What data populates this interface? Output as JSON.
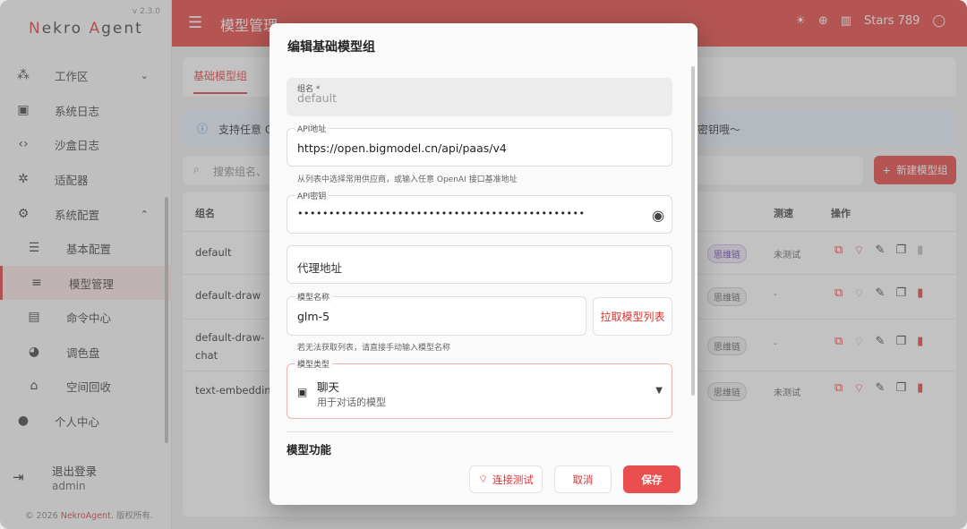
{
  "sidebar": {
    "brand_prefix": "N",
    "brand_main": "ekro ",
    "brand_a": "A",
    "brand_rest": "gent",
    "version": "v 2.3.0",
    "items": [
      {
        "label": "工作区",
        "icon": "workspace-icon",
        "glyph": "⁂"
      },
      {
        "label": "系统日志",
        "icon": "terminal-icon",
        "glyph": "▣"
      },
      {
        "label": "沙盒日志",
        "icon": "code-icon",
        "glyph": "‹›"
      },
      {
        "label": "适配器",
        "icon": "hub-icon",
        "glyph": "✲"
      },
      {
        "label": "系统配置",
        "icon": "gear-icon",
        "glyph": "⚙"
      },
      {
        "label": "基本配置",
        "icon": "tune-icon",
        "glyph": "☰"
      },
      {
        "label": "模型管理",
        "icon": "storage-icon",
        "glyph": "≡"
      },
      {
        "label": "命令中心",
        "icon": "list-icon",
        "glyph": "▤"
      },
      {
        "label": "调色盘",
        "icon": "palette-icon",
        "glyph": "◕"
      },
      {
        "label": "空间回收",
        "icon": "broom-icon",
        "glyph": "⌂"
      },
      {
        "label": "个人中心",
        "icon": "account-icon",
        "glyph": "●"
      }
    ],
    "logout_label": "退出登录",
    "user": "admin",
    "copyright_prefix": "© 2026 ",
    "copyright_brand": "NekroAgent",
    "copyright_suffix": ". 版权所有."
  },
  "topbar": {
    "title": "模型管理",
    "stars": "Stars 789"
  },
  "page": {
    "tab": "基础模型组",
    "info_start": "支持任意 C",
    "info_end": "密钥哦～",
    "search_placeholder": "搜索组名、",
    "new_button": "新建模型组",
    "columns": {
      "name": "组名",
      "speed": "测速",
      "ops": "操作"
    },
    "rows": [
      {
        "name": "default",
        "chip": "思维链",
        "test": "未测试"
      },
      {
        "name": "default-draw",
        "chip": "思维链",
        "test": "-"
      },
      {
        "name": "default-draw-\nchat",
        "chip": "思维链",
        "test": "-"
      },
      {
        "name": "text-embedding",
        "chip": "思维链",
        "test": "未测试"
      }
    ]
  },
  "dialog": {
    "title": "编辑基础模型组",
    "group_name_label": "组名 *",
    "group_name_value": "default",
    "api_url_label": "API地址",
    "api_url_value": "https://open.bigmodel.cn/api/paas/v4",
    "api_url_helper": "从列表中选择常用供应商，或输入任意 OpenAI 接口基准地址",
    "api_key_label": "API密钥",
    "api_key_value": "••••••••••••••••••••••••••••••••••••••••••••••",
    "proxy_placeholder": "代理地址",
    "model_name_label": "模型名称",
    "model_name_value": "glm-5",
    "pull_models_button": "拉取模型列表",
    "model_name_helper": "若无法获取列表，请直接手动输入模型名称",
    "model_type_label": "模型类型",
    "model_type_value": "聊天",
    "model_type_desc": "用于对话的模型",
    "section_title": "模型功能",
    "test_button": "连接测试",
    "cancel_button": "取消",
    "save_button": "保存"
  },
  "colors": {
    "accent": "#e53935",
    "save": "#ea4f4f"
  }
}
